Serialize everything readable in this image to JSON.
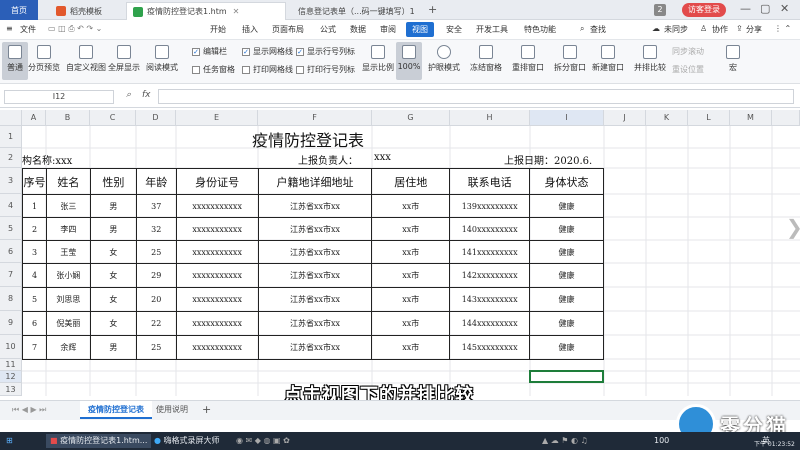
{
  "tabs": {
    "home": "首页",
    "items": [
      {
        "label": "稻壳模板",
        "color": "#e2582c"
      },
      {
        "label": "疫情防控登记表1.htm",
        "color": "#2fa24c"
      },
      {
        "label": "信息登记表单（...码一键填写）1",
        "color": "#2fa24c"
      }
    ],
    "count": "2",
    "visitor": "访客登录"
  },
  "menu": {
    "file": "文件",
    "items": [
      "开始",
      "插入",
      "页面布局",
      "公式",
      "数据",
      "审阅",
      "视图",
      "安全",
      "开发工具",
      "特色功能"
    ],
    "active": "视图",
    "search": "查找",
    "sync": "未同步",
    "collab": "协作",
    "share": "分享"
  },
  "ribbon": {
    "buttons": [
      "普通",
      "分页预览",
      "自定义视图",
      "全屏显示",
      "阅读模式",
      "显示比例",
      "100%",
      "护眼模式",
      "冻结窗格",
      "重排窗口",
      "拆分窗口",
      "新建窗口",
      "并排比较",
      "宏"
    ],
    "checkboxes": [
      {
        "label": "编辑栏",
        "checked": true
      },
      {
        "label": "显示网格线",
        "checked": true
      },
      {
        "label": "显示行号列标",
        "checked": true
      },
      {
        "label": "任务窗格",
        "checked": false
      },
      {
        "label": "打印网格线",
        "checked": false
      },
      {
        "label": "打印行号列标",
        "checked": false
      }
    ],
    "disabled": [
      "同步滚动",
      "重设位置"
    ]
  },
  "formula": {
    "cell_ref": "I12",
    "fx": "fx",
    "value": ""
  },
  "columns": [
    "A",
    "B",
    "C",
    "D",
    "E",
    "F",
    "G",
    "H",
    "I",
    "J",
    "K",
    "L",
    "M"
  ],
  "rows": [
    "1",
    "2",
    "3",
    "4",
    "5",
    "6",
    "7",
    "8",
    "9",
    "10",
    "11",
    "12",
    "13"
  ],
  "sheet": {
    "title": "疫情防控登记表",
    "org_label": "构名称:xxx",
    "reporter_label": "上报负责人：",
    "reporter_value": "xxx",
    "date_label": "上报日期：2020.6.",
    "headers": [
      "序号",
      "姓名",
      "性别",
      "年龄",
      "身份证号",
      "户籍地详细地址",
      "居住地",
      "联系电话",
      "身体状态"
    ],
    "records": [
      [
        "1",
        "张三",
        "男",
        "37",
        "xxxxxxxxxxx",
        "江苏省xx市xx",
        "xx市",
        "139xxxxxxxxx",
        "健康"
      ],
      [
        "2",
        "李四",
        "男",
        "32",
        "xxxxxxxxxxx",
        "江苏省xx市xx",
        "xx市",
        "140xxxxxxxxx",
        "健康"
      ],
      [
        "3",
        "王莹",
        "女",
        "25",
        "xxxxxxxxxxx",
        "江苏省xx市xx",
        "xx市",
        "141xxxxxxxxx",
        "健康"
      ],
      [
        "4",
        "张小娴",
        "女",
        "29",
        "xxxxxxxxxxx",
        "江苏省xx市xx",
        "xx市",
        "142xxxxxxxxx",
        "健康"
      ],
      [
        "5",
        "刘思思",
        "女",
        "20",
        "xxxxxxxxxxx",
        "江苏省xx市xx",
        "xx市",
        "143xxxxxxxxx",
        "健康"
      ],
      [
        "6",
        "倪美丽",
        "女",
        "22",
        "xxxxxxxxxxx",
        "江苏省xx市xx",
        "xx市",
        "144xxxxxxxxx",
        "健康"
      ],
      [
        "7",
        "余辉",
        "男",
        "25",
        "xxxxxxxxxxx",
        "江苏省xx市xx",
        "xx市",
        "145xxxxxxxxx",
        "健康"
      ]
    ]
  },
  "sheet_tabs": [
    "疫情防控登记表",
    "使用说明"
  ],
  "caption": "点击视图下的并排比较",
  "taskbar": {
    "items": [
      "疫情防控登记表1.htm...",
      "嗨格式录屏大师"
    ],
    "zoom": "100",
    "lang": "英",
    "time": "下午 01:23:52"
  },
  "watermark": "零分猫",
  "colors": {
    "brand_blue": "#1f6fd1",
    "home_tab": "#2b5fb8",
    "visitor": "#e24b4b",
    "selection": "#1e7d3a"
  }
}
